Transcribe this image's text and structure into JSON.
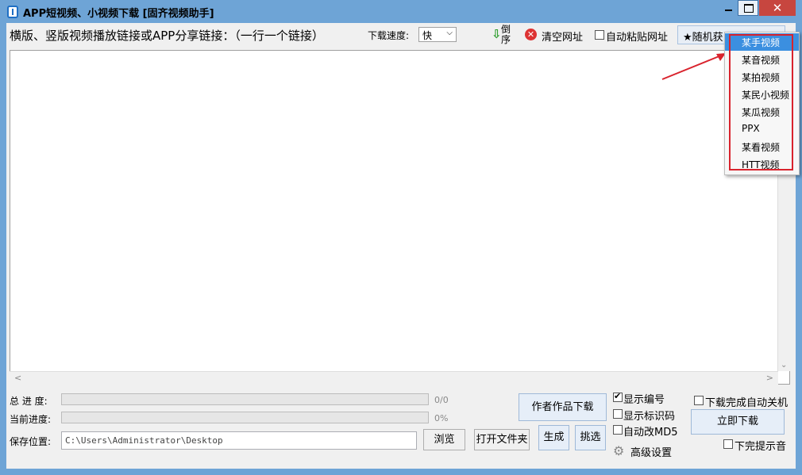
{
  "window": {
    "title": "APP短视频、小视频下载 [固齐视频助手]",
    "close_glyph": "✕"
  },
  "toolbar": {
    "links_label": "横版、竖版视频播放链接或APP分享链接：（一行一个链接）",
    "speed_label": "下载速度:",
    "speed_value": "快",
    "reverse_label": "倒序",
    "clear_label": "清空网址",
    "auto_paste_label": "自动粘贴网址",
    "auto_paste_checked": false,
    "random_label": "★随机获"
  },
  "dropdown": {
    "items": [
      "某手视频",
      "某音视频",
      "某拍视频",
      "某民小视频",
      "某瓜视频",
      "PPX",
      "某看视频",
      "HTT视频"
    ],
    "selected_index": 0
  },
  "progress": {
    "total_label": "总 进 度:",
    "total_text": "0/0",
    "total_fraction": 0,
    "current_label": "当前进度:",
    "current_text": "0%",
    "current_fraction": 0
  },
  "save": {
    "label": "保存位置:",
    "path": "C:\\Users\\Administrator\\Desktop",
    "browse_label": "浏览",
    "open_folder_label": "打开文件夹"
  },
  "actions": {
    "author_download_label": "作者作品下载",
    "generate_label": "生成",
    "pick_label": "挑选",
    "download_now_label": "立即下载",
    "advanced_label": "高级设置"
  },
  "options": {
    "show_number_label": "显示编号",
    "show_number_checked": true,
    "show_mark_label": "显示标识码",
    "show_mark_checked": false,
    "auto_md5_label": "自动改MD5",
    "auto_md5_checked": false,
    "auto_shutdown_label": "下载完成自动关机",
    "auto_shutdown_checked": false,
    "done_sound_label": "下完提示音",
    "done_sound_checked": false
  },
  "colors": {
    "titlebar": "#6ea4d6",
    "close_button": "#c7463f",
    "selected_item": "#3b8fe0",
    "highlight_border": "#d9232d"
  }
}
